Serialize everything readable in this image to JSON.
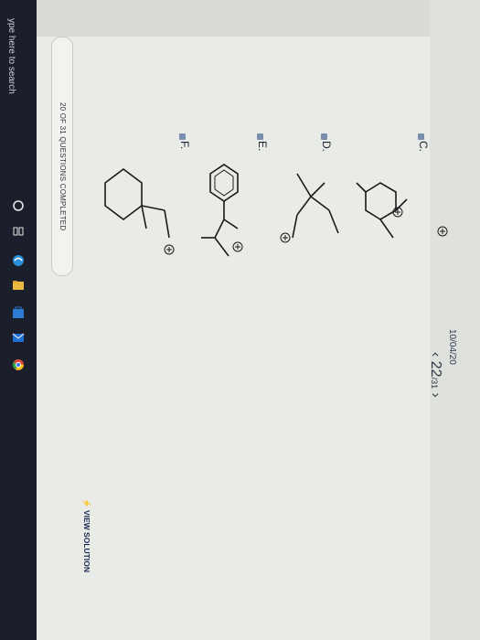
{
  "taskbar": {
    "search_text": "ype here to search"
  },
  "header": {
    "date": "10/04/20"
  },
  "progress": {
    "text": "20 OF 31 QUESTIONS COMPLETED",
    "completed": 20,
    "total": 31
  },
  "options": [
    {
      "letter": "C."
    },
    {
      "letter": "D."
    },
    {
      "letter": "E."
    },
    {
      "letter": "F."
    }
  ],
  "pager": {
    "current": "22",
    "total": "/31",
    "prev": "‹",
    "next": "›"
  },
  "footer": {
    "view_solution": "VIEW SOLUTION"
  },
  "colors": {
    "accent": "#2f4a8a",
    "page_bg": "#e9ebe6",
    "bezel": "#1d2130"
  },
  "icons": [
    "search-icon",
    "task-view-icon",
    "edge-icon",
    "file-explorer-icon",
    "store-icon",
    "mail-icon",
    "chrome-icon",
    "plus-charge-icon"
  ]
}
